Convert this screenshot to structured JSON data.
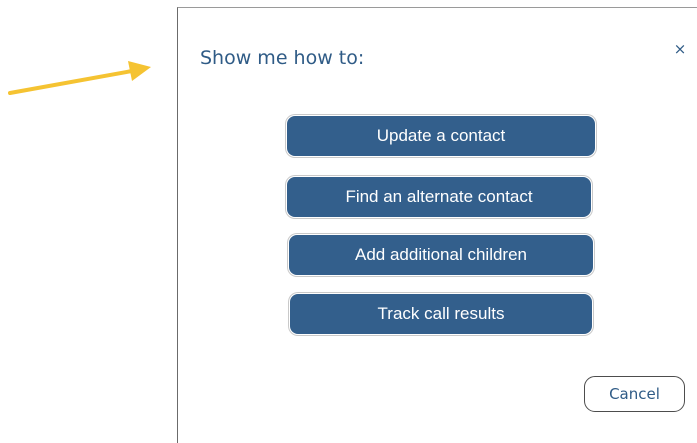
{
  "dialog": {
    "title": "Show me how to:",
    "close_label": "×",
    "options": [
      {
        "label": "Update a contact"
      },
      {
        "label": "Find an alternate contact"
      },
      {
        "label": "Add additional children"
      },
      {
        "label": "Track call results"
      }
    ],
    "cancel_label": "Cancel"
  },
  "annotation": {
    "icon": "arrow-icon",
    "color": "#f5c332"
  },
  "colors": {
    "button_fill": "#335f8c",
    "title_text": "#2f5b86"
  }
}
